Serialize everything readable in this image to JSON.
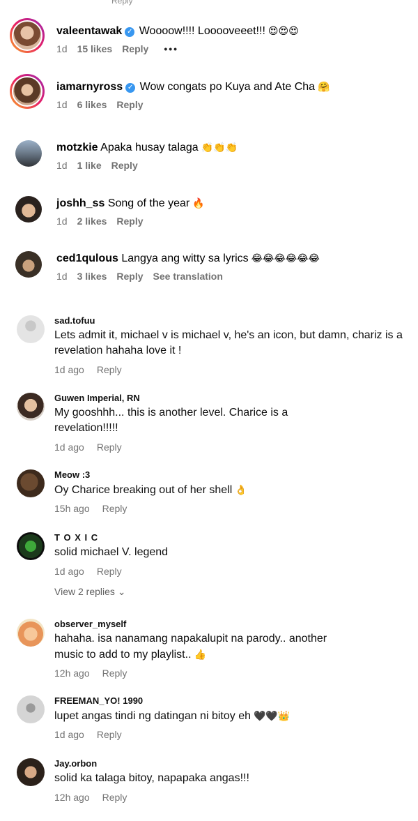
{
  "top_cut_text": "Reply",
  "ig_comments": [
    {
      "user": "valeentawak",
      "text": "Woooow!!!! Looooveeet!!!",
      "emoji": "😍😍😍",
      "age": "1d",
      "likes": "15 likes",
      "reply": "Reply",
      "more": "•••",
      "verified": true
    },
    {
      "user": "iamarnyross",
      "text": "Wow congats po Kuya and Ate Cha",
      "emoji": "🤗",
      "age": "1d",
      "likes": "6 likes",
      "reply": "Reply",
      "verified": true
    },
    {
      "user": "motzkie",
      "text": "Apaka husay talaga",
      "emoji": "👏👏👏",
      "age": "1d",
      "likes": "1 like",
      "reply": "Reply"
    },
    {
      "user": "joshh_ss",
      "text": "Song of the year",
      "emoji": "🔥",
      "age": "1d",
      "likes": "2 likes",
      "reply": "Reply"
    },
    {
      "user": "ced1qulous",
      "text": "Langya ang witty sa lyrics",
      "emoji": "😂😂😂😂😂😂",
      "age": "1d",
      "likes": "3 likes",
      "reply": "Reply",
      "translate": "See translation"
    }
  ],
  "yt_comments": [
    {
      "user": "sad.tofuu",
      "text": "Lets admit it, michael v is michael v, he's an icon, but damn, chariz is a revelation hahaha love it !",
      "age": "1d ago",
      "reply": "Reply"
    },
    {
      "user": "Guwen Imperial, RN",
      "text": "My gooshhh... this is another level. Charice is a revelation!!!!!",
      "age": "1d ago",
      "reply": "Reply"
    },
    {
      "user": "Meow :3",
      "text": "Oy Charice breaking out of her shell",
      "emoji": "👌",
      "age": "15h ago",
      "reply": "Reply"
    },
    {
      "user": "T O X I C",
      "text": "solid michael V. legend",
      "age": "1d ago",
      "reply": "Reply",
      "replies": "View 2 replies ⌄"
    },
    {
      "user": "observer_myself",
      "text": "hahaha. isa nanamang napakalupit na parody.. another music to add to my playlist..",
      "emoji": "👍",
      "age": "12h ago",
      "reply": "Reply"
    },
    {
      "user": "FREEMAN_YO! 1990",
      "text": "lupet angas tindi ng datingan ni bitoy eh",
      "emoji": "🖤🖤👑",
      "age": "1d ago",
      "reply": "Reply"
    },
    {
      "user": "Jay.orbon",
      "text": "solid ka talaga bitoy, napapaka angas!!!",
      "age": "12h ago",
      "reply": "Reply"
    }
  ]
}
